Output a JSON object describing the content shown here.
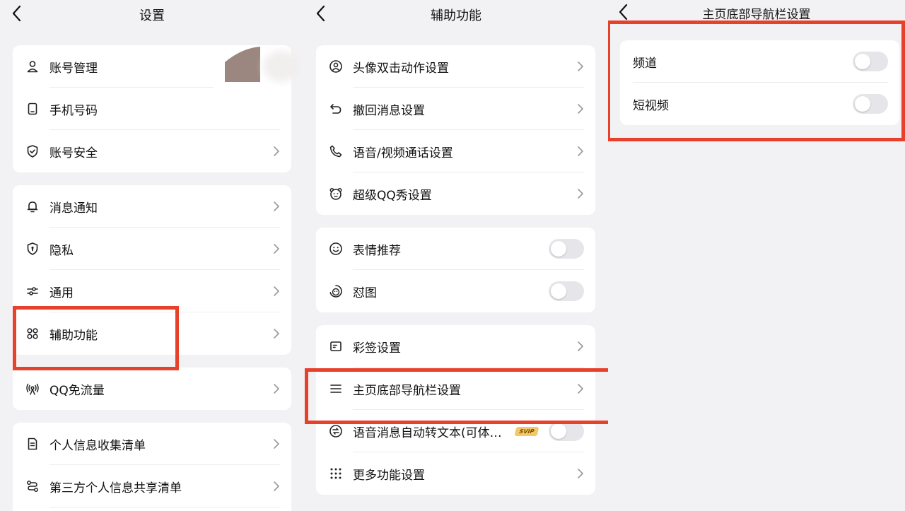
{
  "panel1": {
    "title": "设置",
    "groups": [
      [
        {
          "label": "账号管理",
          "icon": "person-icon",
          "chevron": false
        },
        {
          "label": "手机号码",
          "icon": "phone-device-icon",
          "chevron": false
        },
        {
          "label": "账号安全",
          "icon": "shield-check-icon",
          "chevron": true
        }
      ],
      [
        {
          "label": "消息通知",
          "icon": "bell-icon",
          "chevron": true
        },
        {
          "label": "隐私",
          "icon": "shield-lock-icon",
          "chevron": true
        },
        {
          "label": "通用",
          "icon": "sliders-icon",
          "chevron": true
        },
        {
          "label": "辅助功能",
          "icon": "four-circles-icon",
          "chevron": true
        }
      ],
      [
        {
          "label": "QQ免流量",
          "icon": "signal-tower-icon",
          "chevron": true
        }
      ],
      [
        {
          "label": "个人信息收集清单",
          "icon": "document-list-icon",
          "chevron": true
        },
        {
          "label": "第三方个人信息共享清单",
          "icon": "share-flow-icon",
          "chevron": true
        }
      ]
    ]
  },
  "panel2": {
    "title": "辅助功能",
    "groups": [
      [
        {
          "label": "头像双击动作设置",
          "icon": "avatar-circle-icon",
          "type": "chevron"
        },
        {
          "label": "撤回消息设置",
          "icon": "undo-icon",
          "type": "chevron"
        },
        {
          "label": "语音/视频通话设置",
          "icon": "phone-call-icon",
          "type": "chevron"
        },
        {
          "label": "超级QQ秀设置",
          "icon": "bear-face-icon",
          "type": "chevron"
        }
      ],
      [
        {
          "label": "表情推荐",
          "icon": "smile-icon",
          "type": "toggle",
          "on": false
        },
        {
          "label": "怼图",
          "icon": "swirl-face-icon",
          "type": "toggle",
          "on": false
        }
      ],
      [
        {
          "label": "彩签设置",
          "icon": "tag-card-icon",
          "type": "chevron"
        },
        {
          "label": "主页底部导航栏设置",
          "icon": "menu-lines-icon",
          "type": "chevron"
        },
        {
          "label": "语音消息自动转文本(可体…",
          "icon": "voice-convert-icon",
          "type": "toggle",
          "on": false,
          "badge": "SVIP"
        },
        {
          "label": "更多功能设置",
          "icon": "dot-grid-icon",
          "type": "chevron"
        }
      ]
    ]
  },
  "panel3": {
    "title": "主页底部导航栏设置",
    "items": [
      {
        "label": "频道",
        "on": false
      },
      {
        "label": "短视频",
        "on": false
      }
    ]
  },
  "colors": {
    "background": "#f2f2f4",
    "card": "#ffffff",
    "highlight": "#e8412b",
    "toggle_off": "#e6e6ea",
    "svip": "#f3c867"
  }
}
